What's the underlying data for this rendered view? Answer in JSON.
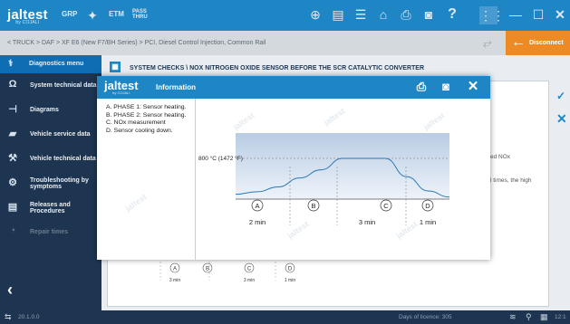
{
  "app": {
    "brand": "jaltest",
    "brand_sub": "by COJALI",
    "nav": {
      "grp": "GRP",
      "etm": "ETM",
      "pass_top": "PASS",
      "pass_bottom": "THRU",
      "help": "?"
    },
    "breadcrumb": "< TRUCK > DAF > XF E6 (New F7/BH Series) > PCI, Diesel Control Injection, Common Rail",
    "disconnect_label": "Disconnect"
  },
  "sidebar": {
    "header": "Diagnostics menu",
    "items": [
      {
        "label": "System technical data",
        "icon": "omega-icon"
      },
      {
        "label": "Diagrams",
        "icon": "diagram-icon"
      },
      {
        "label": "Vehicle service data",
        "icon": "truck-icon"
      },
      {
        "label": "Vehicle technical data",
        "icon": "wrench-icon"
      },
      {
        "label": "Troubleshooting by symptoms",
        "icon": "tools-icon"
      },
      {
        "label": "Releases and Procedures",
        "icon": "book-icon"
      },
      {
        "label": "Repair times",
        "icon": "clock-icon",
        "disabled": true
      }
    ]
  },
  "content": {
    "title": "SYSTEM CHECKS \\ NOX NITROGEN OXIDE SENSOR BEFORE THE SCR CATALYTIC CONVERTER",
    "bg_text_1": "ed NOx",
    "bg_text_2": "l times, the high",
    "bg_phases": [
      "A",
      "B",
      "C",
      "D"
    ],
    "bg_durations": [
      "3 min",
      "3 min",
      "1 min"
    ]
  },
  "status": {
    "version": "20.1.0.0",
    "licence": "Days of licence: 305",
    "time": "12:1"
  },
  "modal": {
    "title": "Information",
    "brand": "jaltest",
    "brand_sub": "by COJALI",
    "legend": [
      "A. PHASE 1: Sensor heating.",
      "B. PHASE 2: Sensor heating.",
      "C. NOx measurement",
      "D. Sensor cooling down."
    ]
  },
  "chart_data": {
    "type": "line",
    "title": "",
    "ylabel": "",
    "xlabel": "",
    "reference_label": "800 °C (1472 °F)",
    "phases": [
      "A",
      "B",
      "C",
      "D"
    ],
    "durations": [
      {
        "label": "2 min"
      },
      {
        "label": "3 min"
      },
      {
        "label": "1 min"
      }
    ],
    "series": [
      {
        "values": [
          0.12,
          0.18,
          0.3,
          0.52,
          0.72,
          1.0,
          1.0,
          1.0,
          0.55,
          0.2,
          0.05
        ]
      }
    ],
    "grid": false
  },
  "colors": {
    "header_blue": "#1f86c6",
    "sidebar_navy": "#1d3550",
    "disconnect_orange": "#ee8a24",
    "curve_blue": "#2b78b4",
    "chart_bg": "#dfe8f3"
  }
}
